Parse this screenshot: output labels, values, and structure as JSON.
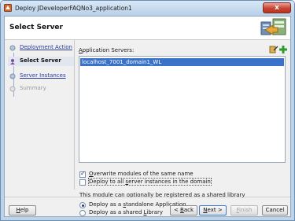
{
  "window": {
    "title": "Deploy JDeveloperFAQNo3_application1",
    "close_label": "x"
  },
  "header": {
    "title": "Select Server",
    "icon": "deploy-server-icon"
  },
  "nav": {
    "items": [
      {
        "label": "Deployment Action",
        "state": "link"
      },
      {
        "label": "Select Server",
        "state": "current"
      },
      {
        "label": "Server Instances",
        "state": "link"
      },
      {
        "label": "Summary",
        "state": "disabled"
      }
    ]
  },
  "content": {
    "servers_label": "Application Servers:",
    "servers_label_mnemonic": "A",
    "servers_label_rest": "pplication Servers:",
    "servers": [
      "localhost_7001_domain1_WL"
    ],
    "selected_server": "localhost_7001_domain1_WL",
    "overwrite": {
      "checked": true,
      "pre": "",
      "mn": "O",
      "post": "verwrite modules of the same name"
    },
    "deploy_all": {
      "checked": false,
      "pre": "Deploy to all ",
      "mn": "s",
      "post": "erver instances in the domain"
    },
    "note": "This module can optionally be registered as a shared library",
    "radio_app": {
      "selected": true,
      "pre": "Deploy as a ",
      "mn": "s",
      "post": "tandalone Application"
    },
    "radio_lib": {
      "selected": false,
      "pre": "Deploy as a shared ",
      "mn": "L",
      "post": "ibrary"
    }
  },
  "buttons": {
    "help": {
      "mn": "H",
      "post": "elp"
    },
    "back": {
      "pre": "< ",
      "mn": "B",
      "post": "ack"
    },
    "next": {
      "mn": "N",
      "post": "ext >"
    },
    "finish": {
      "mn": "F",
      "post": "inish"
    },
    "cancel": {
      "label": "Cancel"
    }
  },
  "colors": {
    "selection": "#3a71c9",
    "link": "#2a3a9a",
    "close": "#c8432f"
  }
}
